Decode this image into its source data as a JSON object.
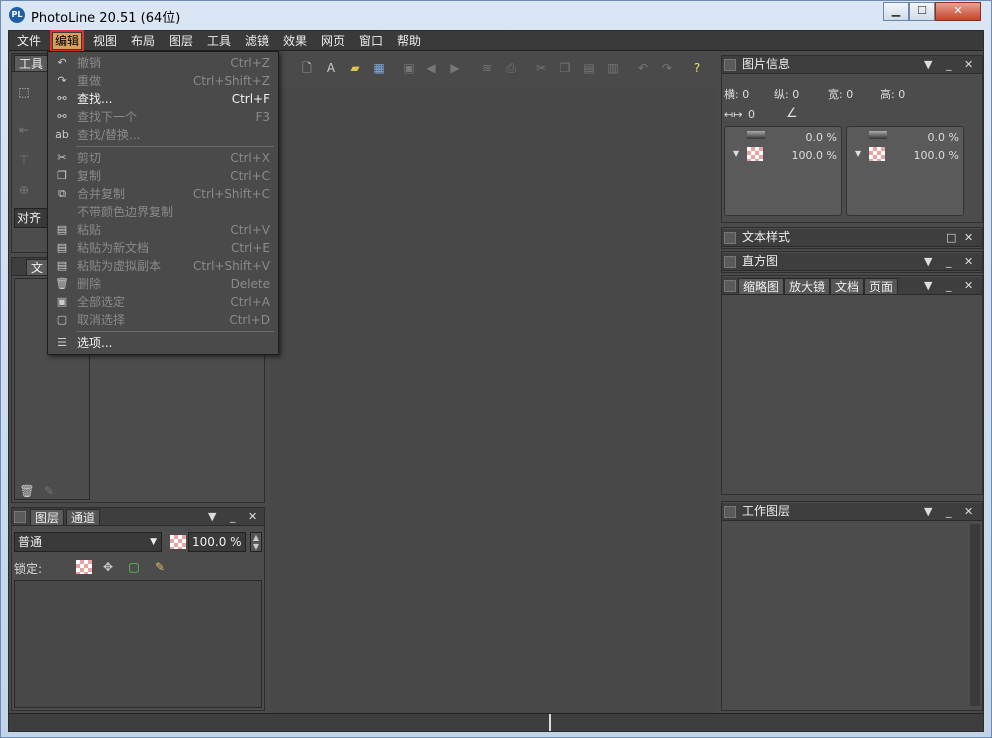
{
  "window": {
    "title": "PhotoLine 20.51 (64位)",
    "app_icon": "PL"
  },
  "menubar": {
    "items": [
      "文件",
      "编辑",
      "视图",
      "布局",
      "图层",
      "工具",
      "滤镜",
      "效果",
      "网页",
      "窗口",
      "帮助"
    ],
    "active": "编辑"
  },
  "edit_menu": [
    {
      "label": "撤销",
      "shortcut": "Ctrl+Z",
      "enabled": false,
      "icon": "undo-icon"
    },
    {
      "label": "重做",
      "shortcut": "Ctrl+Shift+Z",
      "enabled": false,
      "icon": "redo-icon"
    },
    {
      "label": "查找...",
      "shortcut": "Ctrl+F",
      "enabled": true,
      "icon": "binoculars-icon"
    },
    {
      "label": "查找下一个",
      "shortcut": "F3",
      "enabled": false,
      "icon": "find-next-icon"
    },
    {
      "label": "查找/替换...",
      "shortcut": "",
      "enabled": false,
      "icon": "find-replace-icon"
    },
    {
      "label": "剪切",
      "shortcut": "Ctrl+X",
      "enabled": false,
      "icon": "cut-icon"
    },
    {
      "label": "复制",
      "shortcut": "Ctrl+C",
      "enabled": false,
      "icon": "copy-icon"
    },
    {
      "label": "合并复制",
      "shortcut": "Ctrl+Shift+C",
      "enabled": false,
      "icon": "merge-copy-icon"
    },
    {
      "label": "不带颜色边界复制",
      "shortcut": "",
      "enabled": false,
      "icon": ""
    },
    {
      "label": "粘贴",
      "shortcut": "Ctrl+V",
      "enabled": false,
      "icon": "paste-icon"
    },
    {
      "label": "粘贴为新文档",
      "shortcut": "Ctrl+E",
      "enabled": false,
      "icon": "paste-new-icon"
    },
    {
      "label": "粘贴为虚拟副本",
      "shortcut": "Ctrl+Shift+V",
      "enabled": false,
      "icon": "paste-virtual-icon"
    },
    {
      "label": "删除",
      "shortcut": "Delete",
      "enabled": false,
      "icon": "trash-icon"
    },
    {
      "label": "全部选定",
      "shortcut": "Ctrl+A",
      "enabled": false,
      "icon": "select-all-icon"
    },
    {
      "label": "取消选择",
      "shortcut": "Ctrl+D",
      "enabled": false,
      "icon": "deselect-icon"
    },
    {
      "label": "选项...",
      "shortcut": "",
      "enabled": true,
      "icon": "options-icon"
    }
  ],
  "left_panels": {
    "tools_tab": "工具",
    "align_dropdown": "对齐到",
    "doc_tab": "文",
    "layers": {
      "tabs": [
        "图层",
        "通道"
      ],
      "blend_mode": "普通",
      "opacity": "100.0 %",
      "lock_label": "锁定:"
    }
  },
  "right_panels": {
    "image_info": {
      "title": "图片信息",
      "fields": [
        "横: 0",
        "纵: 0",
        "宽: 0",
        "高: 0"
      ],
      "row2": "0",
      "color_boxes": [
        {
          "top": "0.0 %",
          "bottom": "100.0 %"
        },
        {
          "top": "0.0 %",
          "bottom": "100.0 %"
        }
      ]
    },
    "text_style": "文本样式",
    "histogram": "直方图",
    "navigator_tabs": [
      "缩略图",
      "放大镜",
      "文档",
      "页面"
    ],
    "work_layer": "工作图层"
  }
}
